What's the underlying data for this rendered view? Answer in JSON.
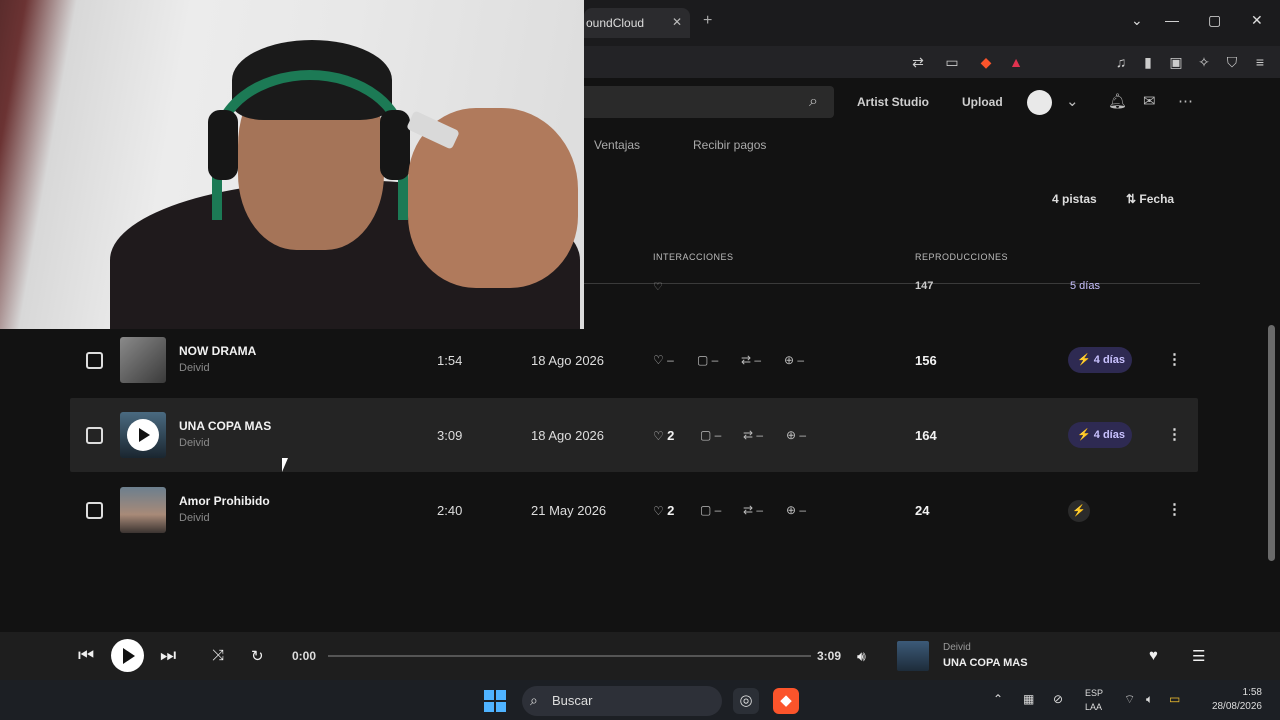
{
  "browser": {
    "tab_title": "oundCloud",
    "tab_close": "✕",
    "new_tab": "+",
    "window_controls": [
      "⌄",
      "—",
      "▢",
      "✕"
    ]
  },
  "site_nav": {
    "search_icon": "search-icon",
    "artist_studio": "Artist Studio",
    "upload": "Upload",
    "sub_tabs": [
      "Ventajas",
      "Recibir pagos"
    ]
  },
  "list": {
    "count": "4 pistas",
    "sort_label": "Fecha",
    "columns": {
      "interactions": "INTERACCIONES",
      "plays": "REPRODUCCIONES"
    },
    "partial_row": {
      "plays": "147",
      "boost": "5 días"
    },
    "tracks": [
      {
        "title": "NOW DRAMA",
        "artist": "Deivid",
        "duration": "1:54",
        "date": "18 Ago 2026",
        "likes": "–",
        "comments": "–",
        "reposts": "–",
        "downloads": "–",
        "plays": "156",
        "boost": "4 días"
      },
      {
        "title": "UNA COPA MAS",
        "artist": "Deivid",
        "duration": "3:09",
        "date": "18 Ago 2026",
        "likes": "2",
        "comments": "–",
        "reposts": "–",
        "downloads": "–",
        "plays": "164",
        "boost": "4 días"
      },
      {
        "title": "Amor Prohibido",
        "artist": "Deivid",
        "duration": "2:40",
        "date": "21 May 2026",
        "likes": "2",
        "comments": "–",
        "reposts": "–",
        "downloads": "–",
        "plays": "24",
        "boost": ""
      }
    ]
  },
  "player": {
    "current_time": "0:00",
    "total_time": "3:09",
    "artist": "Deivid",
    "title": "UNA COPA MAS",
    "progress": 0
  },
  "taskbar": {
    "search_placeholder": "Buscar",
    "lang_top": "ESP",
    "lang_bottom": "LAA",
    "time": "1:58",
    "date": "28/08/2026"
  },
  "colors": {
    "accent_boost": "#2e2a52",
    "background": "#121212",
    "player_bg": "#1e1e1e"
  }
}
